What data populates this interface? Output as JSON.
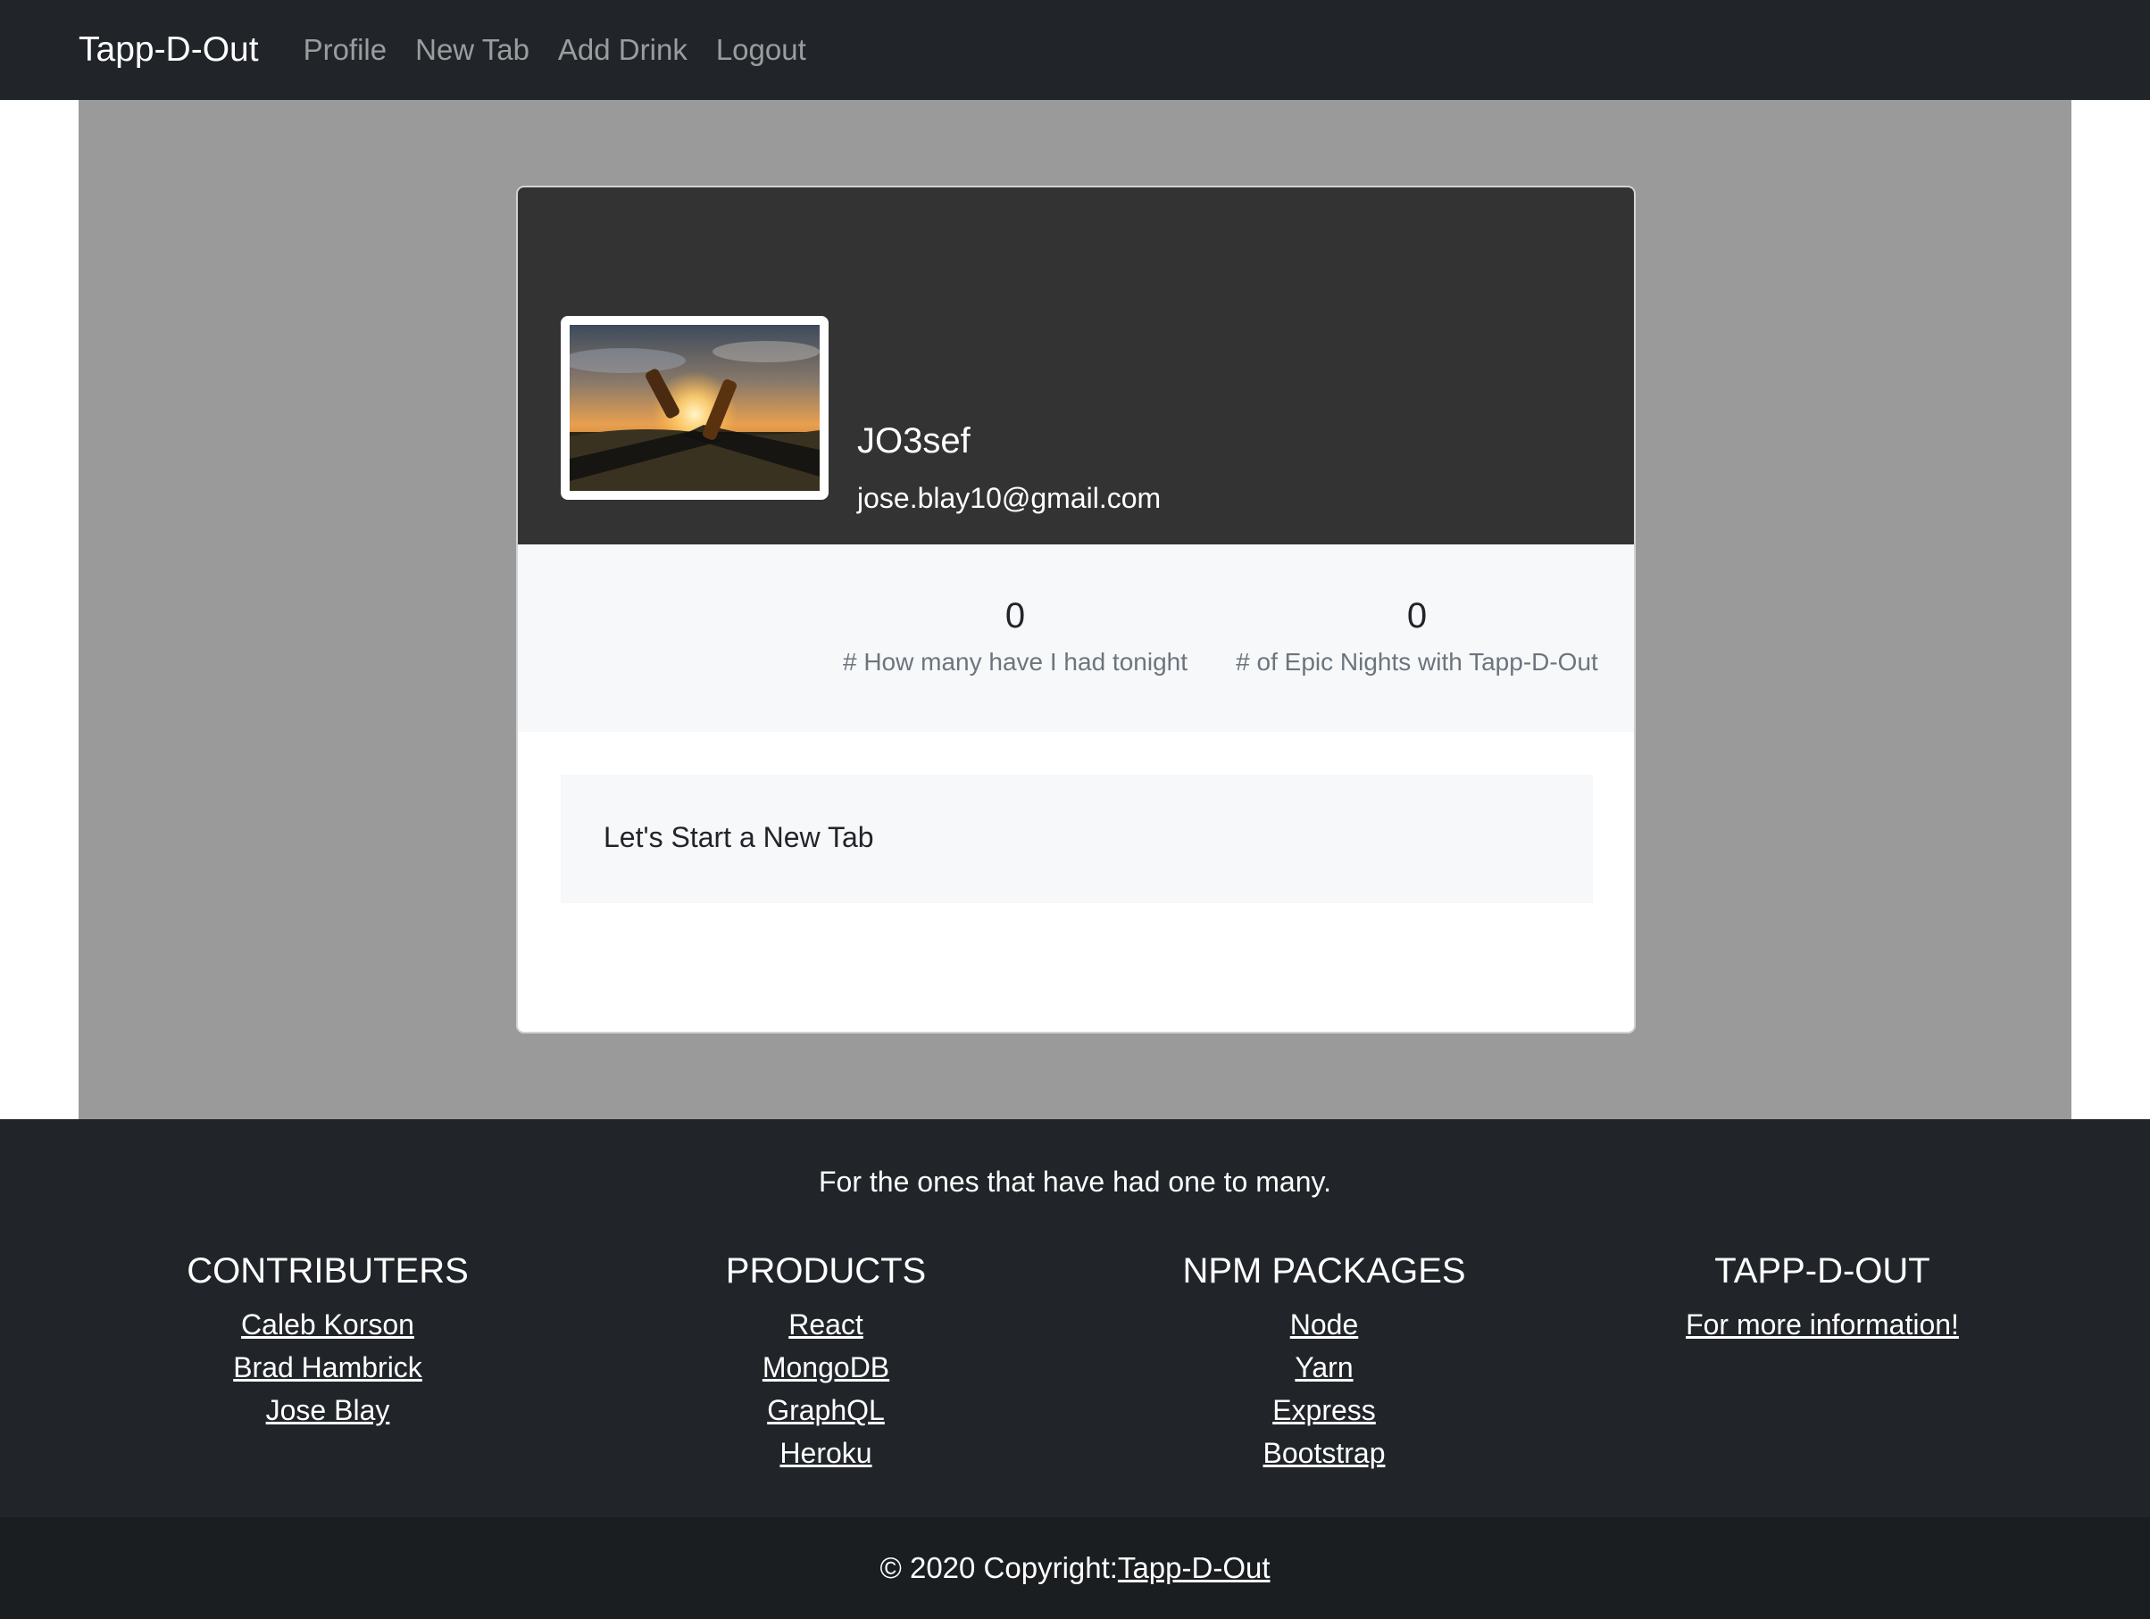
{
  "navbar": {
    "brand": "Tapp-D-Out",
    "links": [
      "Profile",
      "New Tab",
      "Add Drink",
      "Logout"
    ]
  },
  "profile": {
    "username": "JO3sef",
    "email": "jose.blay10@gmail.com",
    "avatar_icon": "beer-toast-photo"
  },
  "stats": [
    {
      "value": "0",
      "label": "# How many have I had tonight"
    },
    {
      "value": "0",
      "label": "# of Epic Nights with Tapp-D-Out"
    }
  ],
  "new_tab": {
    "label": "Let's Start a New Tab"
  },
  "footer": {
    "tagline": "For the ones that have had one to many.",
    "columns": [
      {
        "title": "CONTRIBUTERS",
        "links": [
          "Caleb Korson",
          "Brad Hambrick",
          "Jose Blay"
        ]
      },
      {
        "title": "PRODUCTS",
        "links": [
          "React",
          "MongoDB",
          "GraphQL",
          "Heroku"
        ]
      },
      {
        "title": "NPM PACKAGES",
        "links": [
          "Node",
          "Yarn",
          "Express",
          "Bootstrap"
        ]
      },
      {
        "title": "TAPP-D-OUT",
        "links": [
          "For more information!"
        ]
      }
    ],
    "copyright_prefix": "© 2020 Copyright:",
    "copyright_link": "Tapp-D-Out"
  },
  "colors": {
    "navbar_bg": "#212529",
    "page_bg": "#9a9a9a",
    "card_header_bg": "#333333",
    "muted_text": "#6c757d"
  }
}
